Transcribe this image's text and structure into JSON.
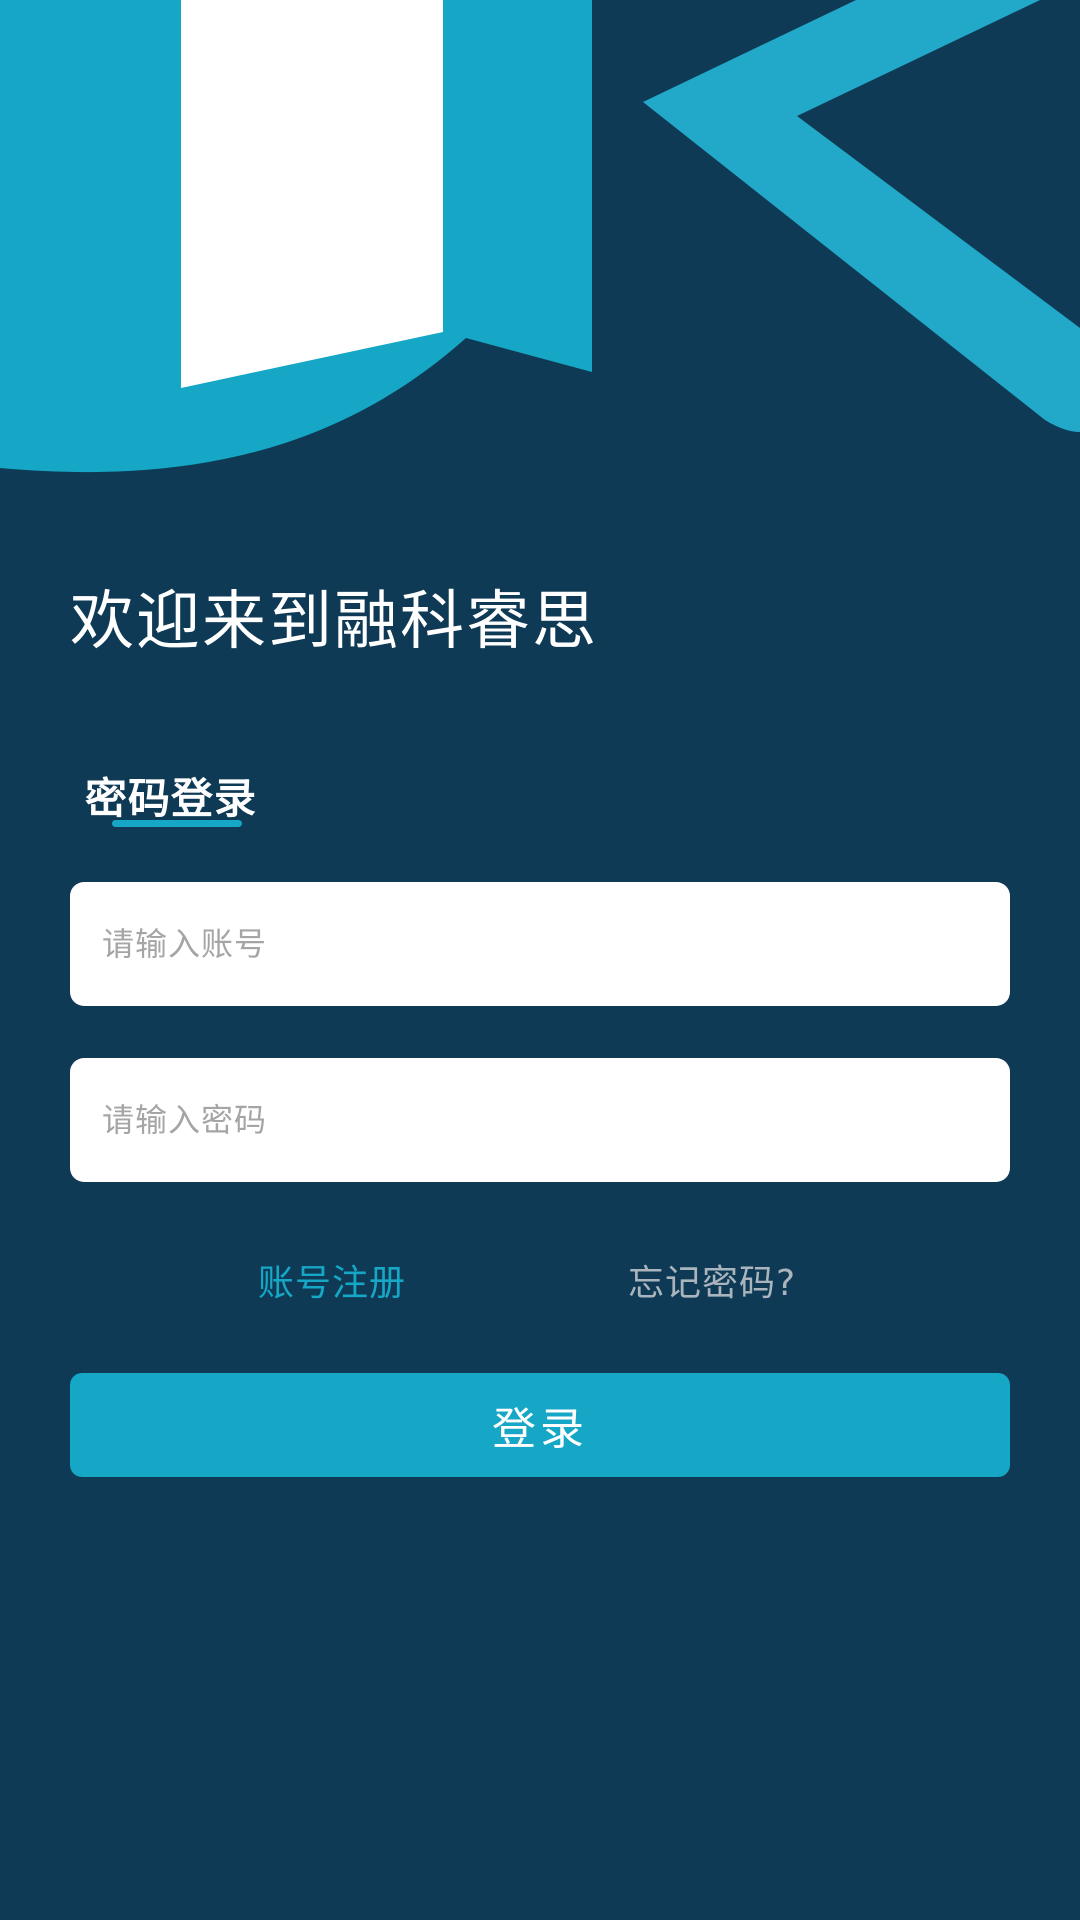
{
  "colors": {
    "background": "#0e3a55",
    "accent": "#15a7c5",
    "accent_light": "#22a8c8",
    "field_bg": "#ffffff",
    "placeholder": "#a5a5a5",
    "muted_link": "#a9b4bd"
  },
  "header": {
    "welcome_title": "欢迎来到融科睿思"
  },
  "login_tabs": {
    "active_tab_label": "密码登录"
  },
  "form": {
    "account_placeholder": "请输入账号",
    "account_value": "",
    "password_placeholder": "请输入密码",
    "password_value": ""
  },
  "links": {
    "register_label": "账号注册",
    "forgot_label": "忘记密码?"
  },
  "actions": {
    "login_label": "登录"
  }
}
